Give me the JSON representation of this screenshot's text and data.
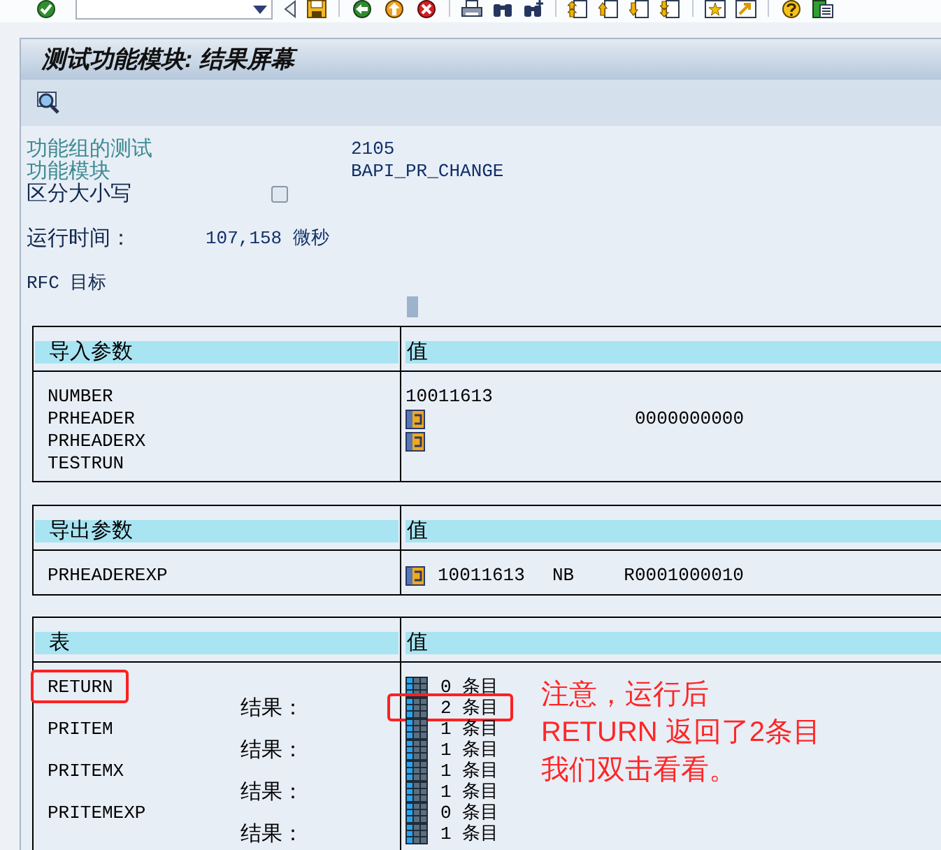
{
  "window": {
    "title": "测试功能模块: 结果屏幕"
  },
  "header_fields": [
    {
      "kind": "text",
      "label": "功能组的测试",
      "value": "2105"
    },
    {
      "kind": "text",
      "label": "功能模块",
      "value": "BAPI_PR_CHANGE"
    },
    {
      "kind": "checkbox",
      "label": "区分大小写",
      "checked": false
    }
  ],
  "runtime": {
    "label": "运行时间：",
    "value": "107,158 微秒"
  },
  "rfc_target": {
    "label": "RFC 目标"
  },
  "import_parameters": {
    "column_1": "导入参数",
    "column_2": "值",
    "rows": [
      {
        "name": "NUMBER",
        "kind": "text",
        "values": [
          "10011613"
        ]
      },
      {
        "name": "PRHEADER",
        "kind": "structure",
        "values": [
          "0000000000"
        ]
      },
      {
        "name": "PRHEADERX",
        "kind": "structure"
      },
      {
        "name": "TESTRUN",
        "kind": "blank"
      }
    ]
  },
  "export_parameters": {
    "column_1": "导出参数",
    "column_2": "值",
    "rows": [
      {
        "name": "PRHEADEREXP",
        "kind": "structure",
        "values": [
          "10011613",
          "NB",
          "R0001000010"
        ]
      }
    ]
  },
  "tables": {
    "column_1": "表",
    "column_2": "值",
    "rows": [
      {
        "name": "RETURN",
        "name_highlighted": true,
        "entries": "0 条目",
        "result_label": "结果：",
        "result_entries": "2 条目",
        "result_highlighted": true
      },
      {
        "name": "PRITEM",
        "name_highlighted": false,
        "entries": "1 条目",
        "result_label": "结果：",
        "result_entries": "1 条目",
        "result_highlighted": false
      },
      {
        "name": "PRITEMX",
        "name_highlighted": false,
        "entries": "1 条目",
        "result_label": "结果：",
        "result_entries": "1 条目",
        "result_highlighted": false
      },
      {
        "name": "PRITEMEXP",
        "name_highlighted": false,
        "entries": "0 条目",
        "result_label": "结果：",
        "result_entries": "1 条目",
        "result_highlighted": false
      }
    ]
  },
  "annotation": {
    "lines": [
      "注意，运行后",
      "RETURN 返回了2条目",
      "我们双击看看。"
    ]
  }
}
